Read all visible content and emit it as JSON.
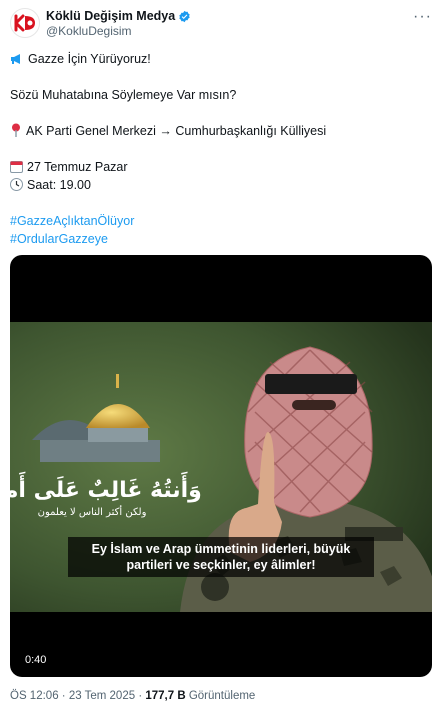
{
  "author": {
    "display_name": "Köklü Değişim Medya",
    "handle": "@KokluDegisim",
    "avatar_text": "KD",
    "verified": true
  },
  "tweet": {
    "line1": "Gazze İçin Yürüyoruz!",
    "line2": "Sözü Muhatabına Söylemeye Var mısın?",
    "location": "AK Parti Genel Merkezi → Cumhurbaşkanlığı Külliyesi",
    "date": "27 Temmuz Pazar",
    "time": "Saat: 19.00",
    "hashtag1": "#GazzeAçlıktanÖlüyor",
    "hashtag2": "#OrdularGazzeye"
  },
  "media": {
    "subtitle_line1": "Ey İslam ve Arap ümmetinin liderleri, büyük",
    "subtitle_line2": "partileri ve seçkinler, ey âlimler!",
    "duration": "0:40",
    "arabic_banner": "وَأَنتُهُ غَالِبٌ عَلَى أَمرِهِ",
    "arabic_subline": "ولكن أكثر الناس لا يعلمون"
  },
  "meta": {
    "time": "ÖS 12:06",
    "date": "23 Tem 2025",
    "views": "177,7 B",
    "views_label": "Görüntüleme"
  },
  "colors": {
    "accent": "#1d9bf0",
    "text": "#0f1419",
    "muted": "#536471",
    "brand_red": "#d9121f"
  }
}
